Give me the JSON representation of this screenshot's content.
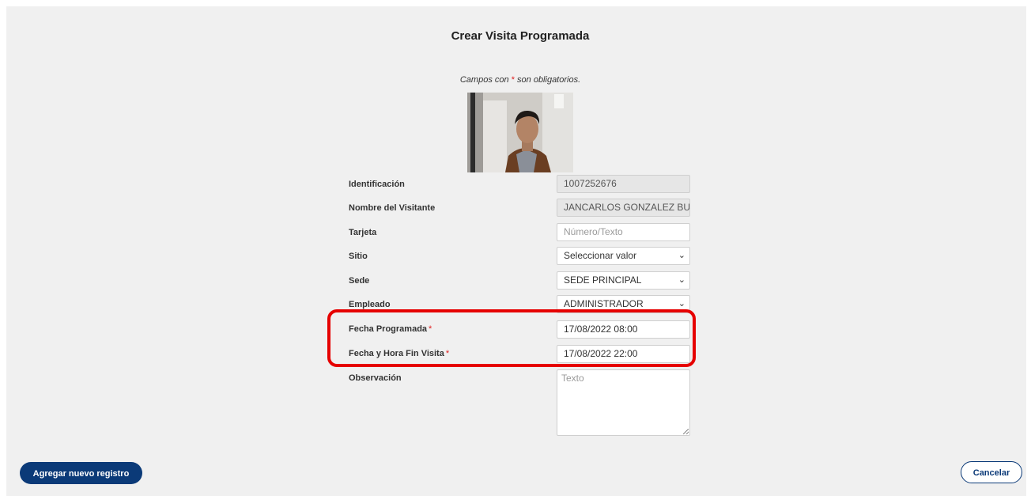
{
  "form": {
    "title": "Crear Visita Programada",
    "note_prefix": "Campos con",
    "note_star": "*",
    "note_suffix": "son obligatorios."
  },
  "fields": {
    "identificacion": {
      "label": "Identificación",
      "value": "1007252676"
    },
    "nombre": {
      "label": "Nombre del Visitante",
      "value": "JANCARLOS GONZALEZ BUITR"
    },
    "tarjeta": {
      "label": "Tarjeta",
      "placeholder": "Número/Texto"
    },
    "sitio": {
      "label": "Sitio",
      "value": "Seleccionar valor"
    },
    "sede": {
      "label": "Sede",
      "value": "SEDE PRINCIPAL"
    },
    "empleado": {
      "label": "Empleado",
      "value": "ADMINISTRADOR"
    },
    "fecha_programada": {
      "label": "Fecha Programada",
      "required": "*",
      "value": "17/08/2022 08:00"
    },
    "fecha_fin": {
      "label": "Fecha y Hora Fin Visita",
      "required": "*",
      "value": "17/08/2022 22:00"
    },
    "observacion": {
      "label": "Observación",
      "placeholder": "Texto"
    }
  },
  "buttons": {
    "add": "Agregar nuevo registro",
    "cancel": "Cancelar"
  },
  "icons": {
    "dropdown": "chevron-down-icon"
  },
  "colors": {
    "primary": "#0b3a78",
    "required": "#e02020",
    "highlight": "#e60000"
  }
}
